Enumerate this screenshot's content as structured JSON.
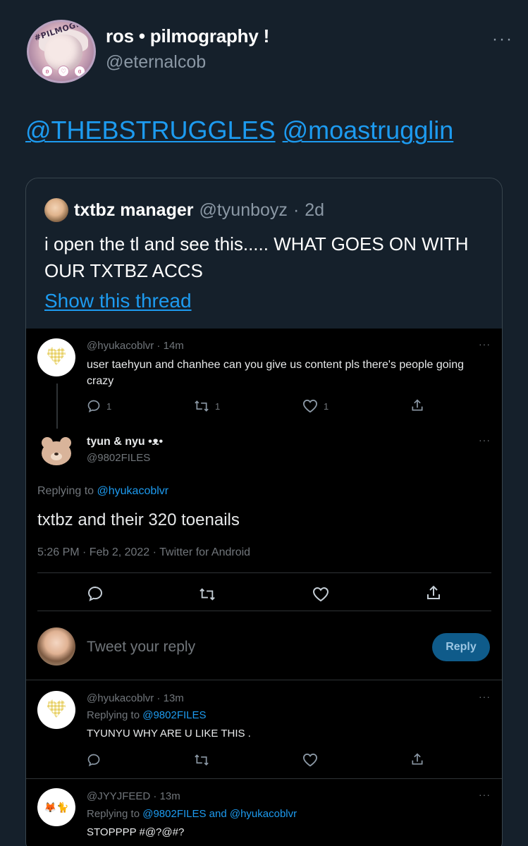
{
  "main_tweet": {
    "author_name": "ros • pilmography !",
    "author_handle": "@eternalcob",
    "avatar_text": "#PILMOGRAPHY",
    "mentions": [
      "@THEBSTRUGGLES",
      "@moastrugglin"
    ]
  },
  "quoted_tweet": {
    "author_name": "txtbz manager",
    "author_handle": "@tyunboyz",
    "separator": "·",
    "time": "2d",
    "text": "i open the tl and see this..... WHAT GOES ON WITH OUR TXTBZ ACCS",
    "show_thread": "Show this thread"
  },
  "screenshot": {
    "first": {
      "handle_time": "@hyukacoblvr · 14m",
      "text": "user taehyun and chanhee can you give us content pls there's people going crazy",
      "reply_count": "1",
      "retweet_count": "1",
      "like_count": "1"
    },
    "main": {
      "name": "tyun & nyu •ᴥ•",
      "handle": "@9802FILES",
      "replying_prefix": "Replying to",
      "replying_to": "@hyukacoblvr",
      "text": "txtbz and their 320 toenails",
      "meta": "5:26 PM · Feb 2, 2022 · Twitter for Android"
    },
    "composer": {
      "placeholder": "Tweet your reply",
      "button": "Reply"
    },
    "reply1": {
      "handle_time": "@hyukacoblvr · 13m",
      "replying_prefix": "Replying to",
      "replying_to": "@9802FILES",
      "text": "TYUNYU WHY ARE U LIKE THIS ."
    },
    "reply2": {
      "handle_time": "@JYYJFEED · 13m",
      "avatar_text": "🦊🐈",
      "replying_prefix": "Replying to",
      "replying_to": "@9802FILES and @hyukacoblvr",
      "text": "STOPPPP #@?@#?"
    },
    "more": "···"
  },
  "colors": {
    "background": "#15202b",
    "link": "#1d9bf0",
    "muted": "#8b98a5",
    "screenshot_bg": "#000000"
  }
}
